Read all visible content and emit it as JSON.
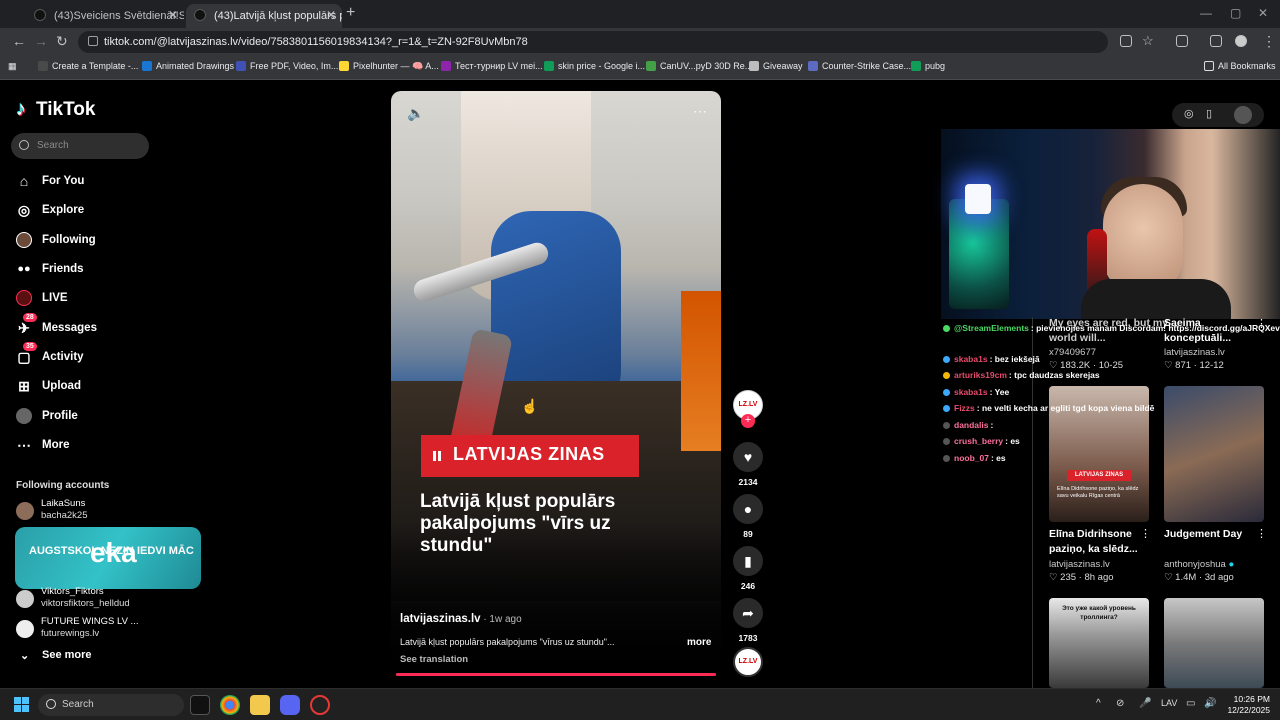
{
  "browser": {
    "tabs": [
      {
        "title": "(43)Sveiciens SvētdienāI!Sveicien"
      },
      {
        "title": "(43)Latvijā kļust populārs pakal"
      }
    ],
    "new_tab": "+",
    "url": "tiktok.com/@latvijaszinas.lv/video/7583801156019834134?_r=1&_t=ZN-92F8UvMbn78",
    "bookmarks": [
      {
        "label": "Create a Template -...",
        "color": "#4a4a4a"
      },
      {
        "label": "Animated Drawings",
        "color": "#1976d2"
      },
      {
        "label": "Free PDF, Video, Im...",
        "color": "#3f51b5"
      },
      {
        "label": "Pixelhunter — 🧠 A...",
        "color": "#fdd835"
      },
      {
        "label": "Тест-турнир LV mei...",
        "color": "#8e24aa"
      },
      {
        "label": "skin price - Google i...",
        "color": "#0f9d58"
      },
      {
        "label": "CanUV...pyD 30D Re...",
        "color": "#43a047"
      },
      {
        "label": "Giveaway",
        "color": "#bdbdbd"
      },
      {
        "label": "Counter-Strike Case...",
        "color": "#5c6bc0"
      },
      {
        "label": "pubg",
        "color": "#0f9d58"
      }
    ],
    "all_bookmarks": "All Bookmarks"
  },
  "tiktok": {
    "logo": "TikTok",
    "search_placeholder": "Search",
    "nav": [
      {
        "label": "For You",
        "icon": "home-icon",
        "glyph": "⌂"
      },
      {
        "label": "Explore",
        "icon": "compass-icon",
        "glyph": "◎"
      },
      {
        "label": "Following",
        "icon": "following-icon",
        "glyph": "●"
      },
      {
        "label": "Friends",
        "icon": "friends-icon",
        "glyph": "👥"
      },
      {
        "label": "LIVE",
        "icon": "live-icon",
        "glyph": "◉"
      },
      {
        "label": "Messages",
        "icon": "messages-icon",
        "glyph": "✈",
        "badge": "28"
      },
      {
        "label": "Activity",
        "icon": "activity-icon",
        "glyph": "▢",
        "badge": "35"
      },
      {
        "label": "Upload",
        "icon": "upload-icon",
        "glyph": "⊞"
      },
      {
        "label": "Profile",
        "icon": "profile-icon",
        "glyph": "●"
      },
      {
        "label": "More",
        "icon": "more-icon",
        "glyph": "⋯"
      }
    ],
    "following_title": "Following accounts",
    "following": [
      {
        "name": "LaikaSuns",
        "handle": "bacha2k25"
      },
      {
        "name": "Viktors_Fiktors",
        "handle": "viktorsfiktors_helldud"
      },
      {
        "name": "FUTURE WINGS LV ...",
        "handle": "futurewings.lv"
      }
    ],
    "overlay_banner": {
      "small": "AUGSTSKOL NEZIN IEDVI MĀC",
      "big": "eka"
    },
    "see_more": "See more"
  },
  "video": {
    "banner": "LATVIJAS ZINAS",
    "headline": "Latvijā kļust populārs pakalpojums \"vīrs uz stundu\"",
    "author": "latvijaszinas.lv",
    "ago": " · 1w ago",
    "caption": "Latvijā kļust populārs pakalpojums \"vīrus uz stundu\"...",
    "more": "more",
    "see_translation": "See translation",
    "avatar_text": "LZ.LV",
    "likes": "2134",
    "comments": "89",
    "saves": "246",
    "shares": "1783"
  },
  "stream_chat": [
    {
      "user": "@StreamElements",
      "text": ": pievienojies manam Discordam! https://discord.gg/aJRQXev",
      "color": "#4cd964"
    },
    {
      "user": "skaba1s",
      "text": ": bez iekšejā",
      "color": "#e74c6c"
    },
    {
      "user": "arturiks19cm",
      "text": ": tpc daudzas skerejas",
      "color": "#e74c6c"
    },
    {
      "user": "skaba1s",
      "text": ": Yee",
      "color": "#e74c6c"
    },
    {
      "user": "Fizzs",
      "text": ": ne velti kecha ar egliti tgd kopa viena bildē",
      "color": "#e74c6c"
    },
    {
      "user": "dandalis",
      "text": ":",
      "color": "#ff6f9c"
    },
    {
      "user": "crush_berry",
      "text": ": es",
      "color": "#ff6f9c"
    },
    {
      "user": "noob_07",
      "text": ": es",
      "color": "#ff6f9c"
    }
  ],
  "grid": [
    {
      "title": "My eyes are red, but my world will...",
      "author": "x79409677",
      "views": "183.2K",
      "date": "10-25"
    },
    {
      "title": "Saeima konceptuāli...",
      "author": "latvijaszinas.lv",
      "views": "871",
      "date": "12-12"
    },
    {
      "title": "Elīna Didrihsone paziņo, ka slēdz...",
      "author": "latvijaszinas.lv",
      "views": "235",
      "date": "8h ago",
      "thumb_banner": "LATVIJAS ZINAS",
      "thumb_caption": "Elīna Didrihsone paziņo, ka slēdz savu veikalu Rīgas centrā"
    },
    {
      "title": "Judgement Day",
      "author": "anthonyjoshua",
      "views": "1.4M",
      "date": "3d ago"
    },
    {
      "thumb_caption": "Это уже какой уровень троллинга?"
    }
  ],
  "taskbar": {
    "search": "Search",
    "lang": "LAV",
    "time": "10:26 PM",
    "date": "12/22/2025"
  }
}
